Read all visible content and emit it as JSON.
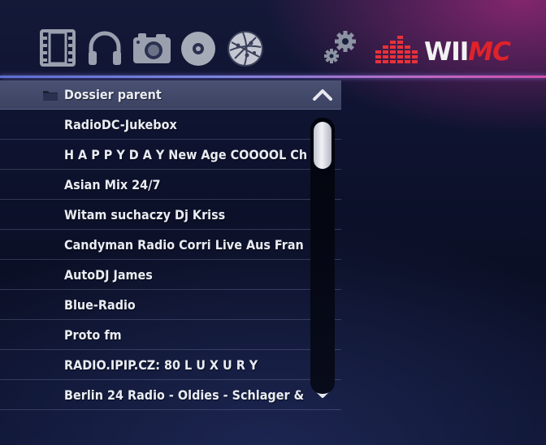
{
  "media_bar": {
    "icons": [
      "video-icon",
      "music-icon",
      "photo-icon",
      "disc-icon",
      "web-icon"
    ],
    "settings_icon": "settings-icon",
    "logo": {
      "main": "WII",
      "accent": "MC",
      "accent_color": "#e0222a"
    }
  },
  "list": {
    "parent_label": "Dossier parent",
    "items": [
      "RadioDC-Jukebox",
      "H A P P Y D A Y New Age COOOOL Ch",
      "Asian Mix 24/7",
      "Witam suchaczy Dj Kriss",
      "Candyman Radio Corri Live Aus Fran",
      "AutoDJ James",
      "Blue-Radio",
      "Proto fm",
      "RADIO.IPIP.CZ: 80 L U X U R Y",
      "Berlin 24 Radio - Oldies - Schlager &"
    ]
  },
  "colors": {
    "accent_line": "#7b86df",
    "parent_row": "#434a6a"
  }
}
